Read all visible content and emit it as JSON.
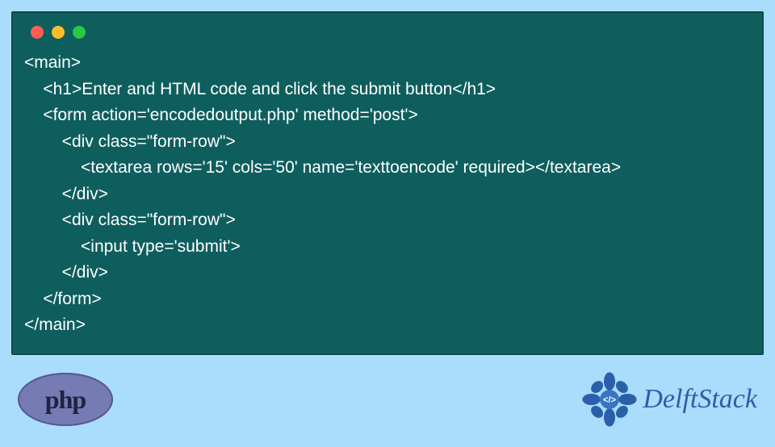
{
  "code": {
    "lines": [
      "<main>",
      "    <h1>Enter and HTML code and click the submit button</h1>",
      "    <form action='encodedoutput.php' method='post'>",
      "        <div class=\"form-row\">",
      "            <textarea rows='15' cols='50' name='texttoencode' required></textarea>",
      "        </div>",
      "        <div class=\"form-row\">",
      "            <input type='submit'>",
      "        </div>",
      "    </form>",
      "</main>"
    ]
  },
  "logos": {
    "php_label": "php",
    "delftstack_label": "DelftStack",
    "delftstack_badge_text": "</>"
  },
  "colors": {
    "page_bg": "#aadcfc",
    "code_bg": "#0f5e5e",
    "php_bg": "#777bb3",
    "delftstack_blue": "#2b5fa8"
  }
}
